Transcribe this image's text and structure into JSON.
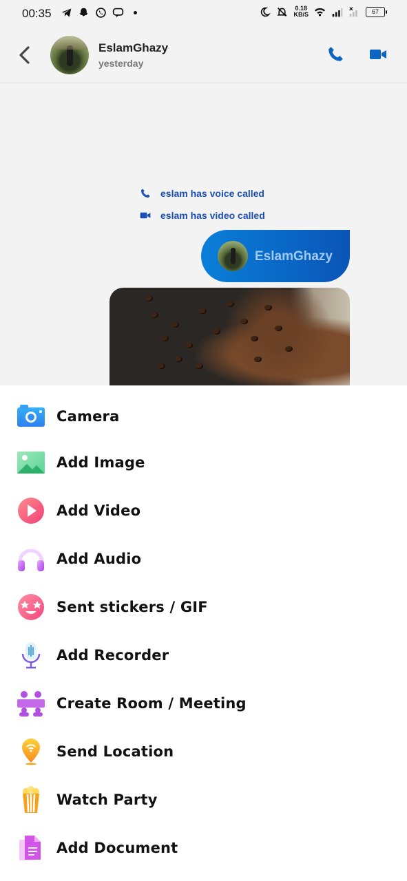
{
  "status_bar": {
    "time": "00:35",
    "speed_value": "0.18",
    "speed_unit": "KB/S",
    "battery": "67"
  },
  "header": {
    "contact_name": "EslamGhazy",
    "last_seen": "yesterday"
  },
  "chat": {
    "call_events": [
      "eslam has voice called",
      "eslam has video called"
    ],
    "shared_contact_name": "EslamGhazy"
  },
  "sheet": {
    "items": [
      {
        "label": "Camera",
        "icon": "camera-icon"
      },
      {
        "label": "Add Image",
        "icon": "image-icon"
      },
      {
        "label": "Add Video",
        "icon": "video-play-icon"
      },
      {
        "label": "Add Audio",
        "icon": "headphones-icon"
      },
      {
        "label": "Sent stickers / GIF",
        "icon": "sticker-icon"
      },
      {
        "label": "Add Recorder",
        "icon": "microphone-icon"
      },
      {
        "label": "Create Room / Meeting",
        "icon": "meeting-icon"
      },
      {
        "label": "Send Location",
        "icon": "location-pin-icon"
      },
      {
        "label": "Watch Party",
        "icon": "popcorn-icon"
      },
      {
        "label": "Add Document",
        "icon": "document-icon"
      }
    ]
  },
  "colors": {
    "accent": "#0a66c2",
    "call_text": "#1a4fb4",
    "bubble_start": "#0a7fd9",
    "bubble_end": "#0a55b7"
  }
}
